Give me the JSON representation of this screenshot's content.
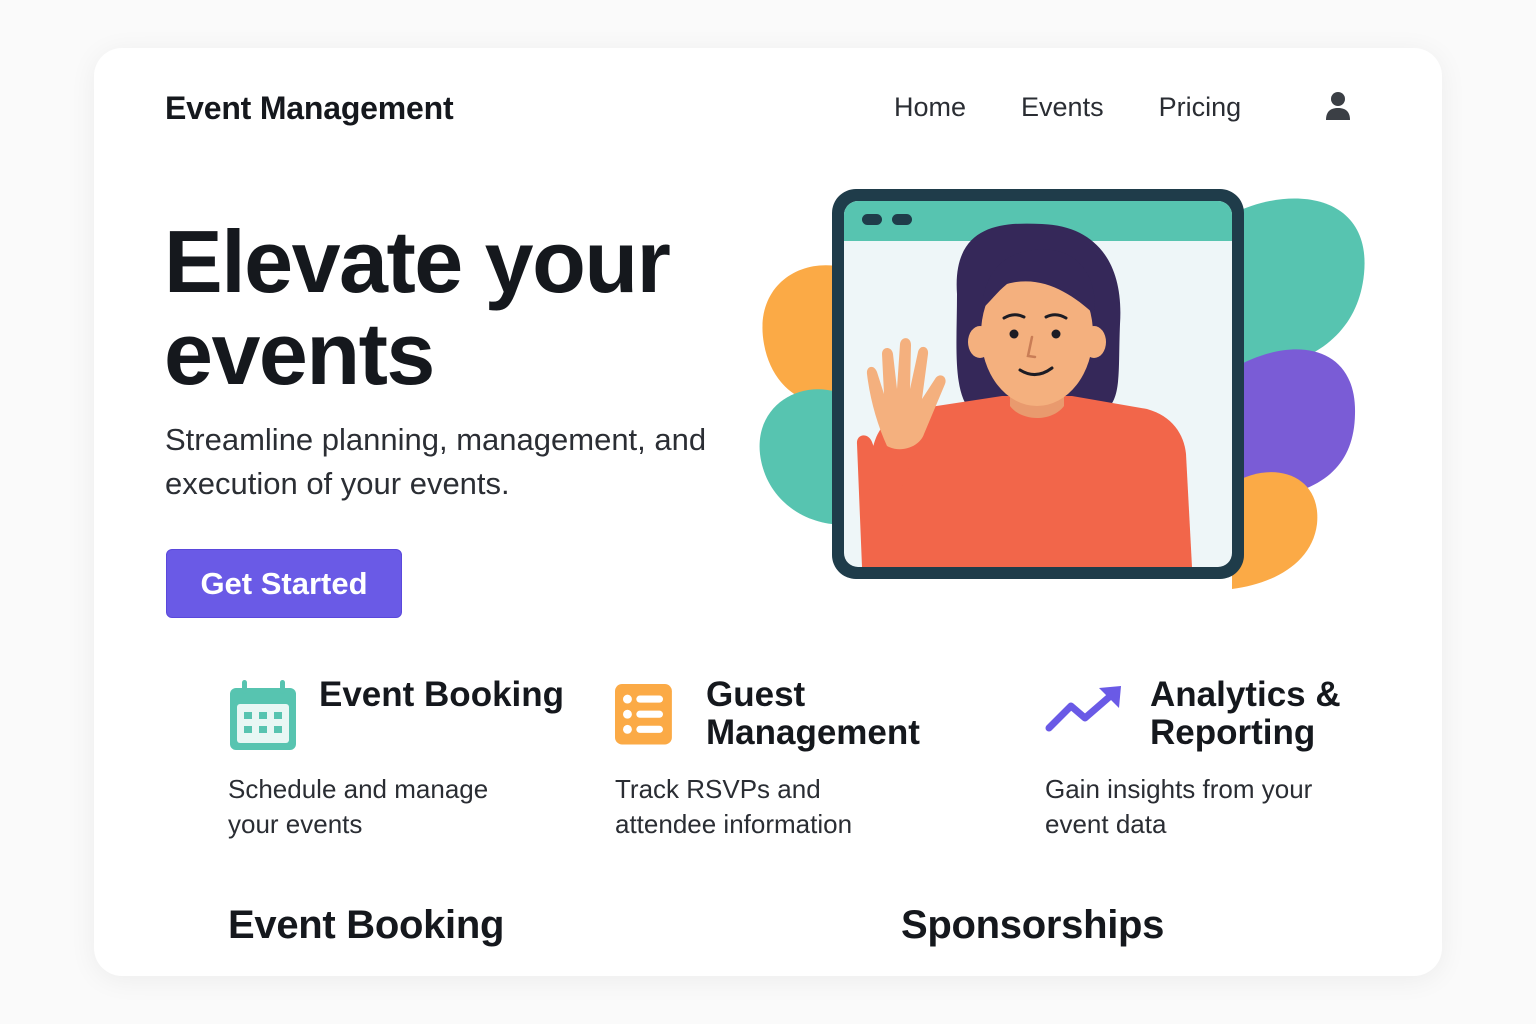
{
  "header": {
    "brand": "Event Management",
    "nav": [
      "Home",
      "Events",
      "Pricing"
    ],
    "user_icon": "user-icon"
  },
  "hero": {
    "title": "Elevate your events",
    "subtitle": "Streamline planning, management, and execution of your events.",
    "cta_label": "Get Started",
    "illustration": "video-call-illustration"
  },
  "features": [
    {
      "icon": "calendar-icon",
      "title": "Event Booking",
      "description": "Schedule and manage your events",
      "color": "#57c4b0"
    },
    {
      "icon": "list-icon",
      "title": "Guest Management",
      "description": "Track RSVPs and attendee information",
      "color": "#fbaa46"
    },
    {
      "icon": "trend-up-icon",
      "title": "Analytics & Reporting",
      "description": "Gain insights from your event data",
      "color": "#6a5ae6"
    }
  ],
  "sections": [
    "Event Booking",
    "Sponsorships"
  ],
  "colors": {
    "accent": "#6a5ae6",
    "teal": "#57c4b0",
    "orange": "#fbaa46",
    "purple": "#7a5cd6",
    "shirt": "#f2664a",
    "frame": "#1f3c4a"
  }
}
